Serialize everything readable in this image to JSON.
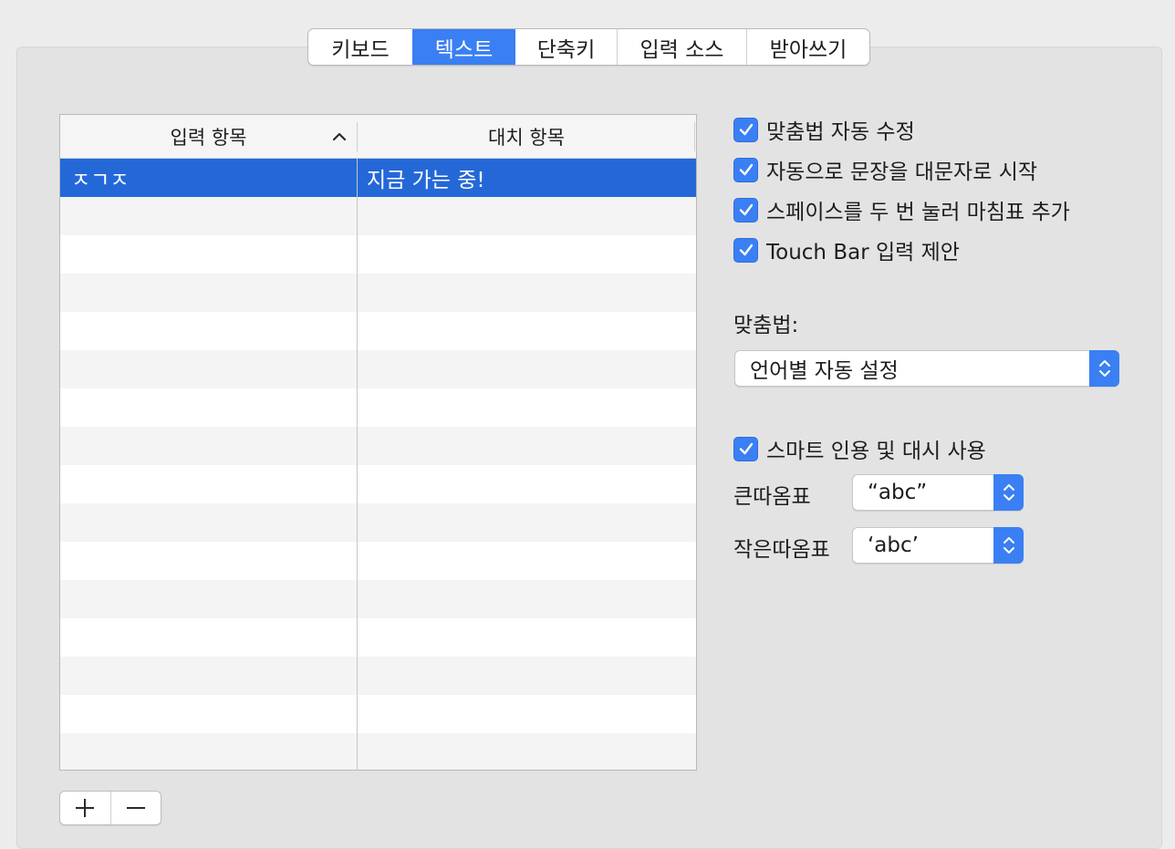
{
  "tabs": [
    {
      "label": "키보드",
      "active": false
    },
    {
      "label": "텍스트",
      "active": true
    },
    {
      "label": "단축키",
      "active": false
    },
    {
      "label": "입력 소스",
      "active": false
    },
    {
      "label": "받아쓰기",
      "active": false
    }
  ],
  "table": {
    "col1_header": "입력 항목",
    "col2_header": "대치 항목",
    "rows": [
      {
        "replace": "ㅈㄱㅈ",
        "with": "지금 가는 중!",
        "selected": true
      }
    ]
  },
  "buttons": {
    "add": "+",
    "remove": "−"
  },
  "options": {
    "autocorrect": {
      "label": "맞춤법 자동 수정",
      "checked": true
    },
    "capitalize": {
      "label": "자동으로 문장을 대문자로 시작",
      "checked": true
    },
    "period": {
      "label": "스페이스를 두 번 눌러 마침표 추가",
      "checked": true
    },
    "touchbar": {
      "label": "Touch Bar 입력 제안",
      "checked": true
    },
    "smart_quotes": {
      "label": "스마트 인용 및 대시 사용",
      "checked": true
    }
  },
  "spelling": {
    "label": "맞춤법:",
    "value": "언어별 자동 설정"
  },
  "double_quotes": {
    "label": "큰따옴표",
    "value": "“abc”"
  },
  "single_quotes": {
    "label": "작은따옴표",
    "value": "‘abc’"
  },
  "colors": {
    "accent": "#3a7ff3",
    "selection": "#2468d8"
  }
}
